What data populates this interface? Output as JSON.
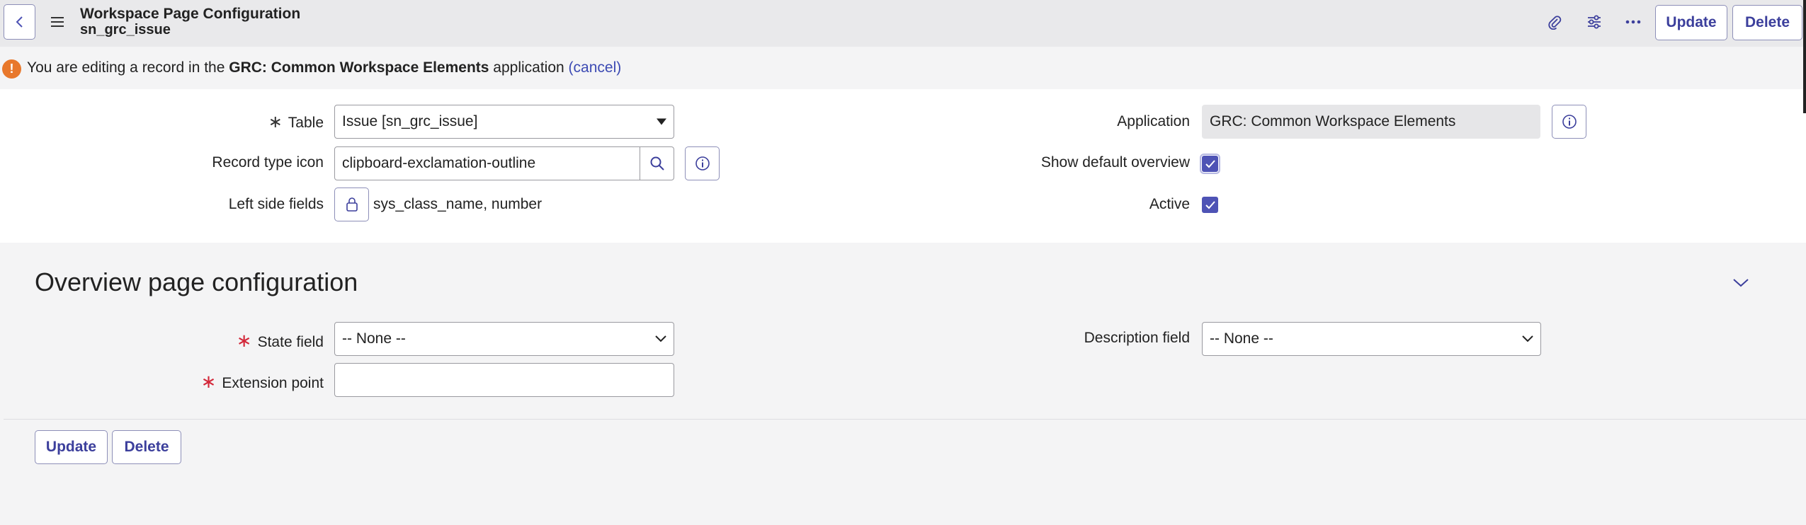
{
  "header": {
    "title": "Workspace Page Configuration",
    "subtitle": "sn_grc_issue",
    "update_label": "Update",
    "delete_label": "Delete"
  },
  "banner": {
    "prefix": "You are editing a record in the ",
    "app_name": "GRC: Common Workspace Elements",
    "suffix": " application ",
    "cancel_label": "(cancel)"
  },
  "form": {
    "table_label": "Table",
    "table_value": "Issue [sn_grc_issue]",
    "record_type_icon_label": "Record type icon",
    "record_type_icon_value": "clipboard-exclamation-outline",
    "left_side_fields_label": "Left side fields",
    "left_side_fields_value": "sys_class_name, number",
    "application_label": "Application",
    "application_value": "GRC: Common Workspace Elements",
    "show_default_overview_label": "Show default overview",
    "show_default_overview_checked": true,
    "active_label": "Active",
    "active_checked": true
  },
  "overview": {
    "title": "Overview page configuration",
    "state_field_label": "State field",
    "state_field_value": "-- None --",
    "description_field_label": "Description field",
    "description_field_value": "-- None --",
    "extension_point_label": "Extension point",
    "extension_point_value": ""
  },
  "footer": {
    "update_label": "Update",
    "delete_label": "Delete"
  },
  "colors": {
    "accent": "#4e53b5",
    "required": "#d3283a",
    "warning": "#e8782c"
  }
}
